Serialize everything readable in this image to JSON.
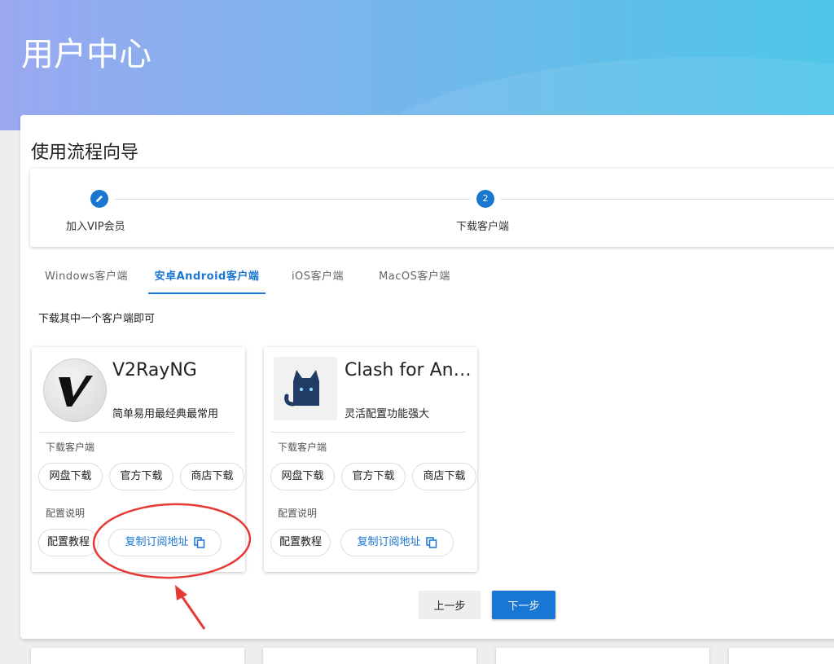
{
  "page": {
    "title": "用户中心"
  },
  "wizard": {
    "title": "使用流程向导",
    "steps": [
      {
        "label": "加入VIP会员",
        "state": "edit",
        "icon": "pencil-icon"
      },
      {
        "label": "下载客户端",
        "state": "active",
        "number": "2"
      }
    ]
  },
  "tabs": [
    {
      "label": "Windows客户端",
      "active": false
    },
    {
      "label": "安卓Android客户端",
      "active": true
    },
    {
      "label": "iOS客户端",
      "active": false
    },
    {
      "label": "MacOS客户端",
      "active": false
    }
  ],
  "hint": "下载其中一个客户端即可",
  "apps": [
    {
      "name": "V2RayNG",
      "description": "简单易用最经典最常用",
      "icon": "v2rayng-logo-icon",
      "download_label": "下载客户端",
      "download_buttons": [
        "网盘下载",
        "官方下载",
        "商店下载"
      ],
      "config_label": "配置说明",
      "config_buttons": [
        "配置教程",
        "复制订阅地址"
      ]
    },
    {
      "name": "Clash for An…",
      "description": "灵活配置功能强大",
      "icon": "clash-cat-icon",
      "download_label": "下载客户端",
      "download_buttons": [
        "网盘下载",
        "官方下载",
        "商店下载"
      ],
      "config_label": "配置说明",
      "config_buttons": [
        "配置教程",
        "复制订阅地址"
      ]
    }
  ],
  "nav": {
    "prev": "上一步",
    "next": "下一步"
  },
  "colors": {
    "primary": "#1976d2",
    "annotation": "#e53935"
  }
}
